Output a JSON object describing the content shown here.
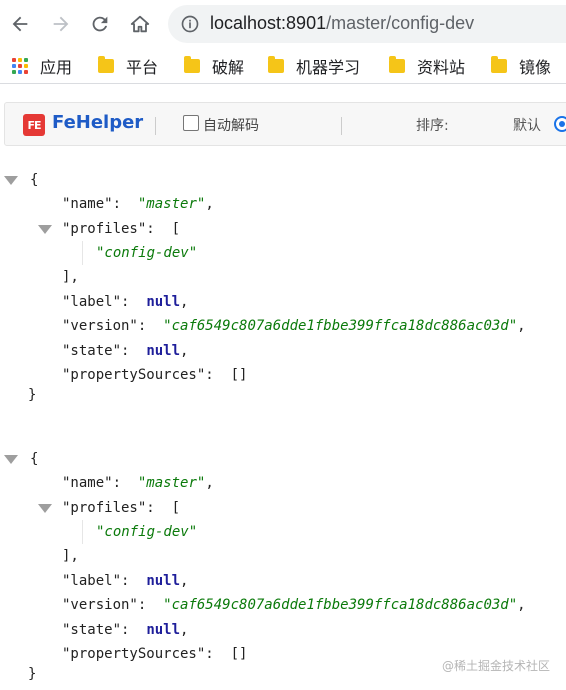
{
  "browser": {
    "url_host": "localhost:8901",
    "url_path": "/master/config-dev"
  },
  "bookmarks": [
    {
      "label": "应用",
      "icon": "apps-grid-icon"
    },
    {
      "label": "平台",
      "icon": "folder-icon"
    },
    {
      "label": "破解",
      "icon": "folder-icon"
    },
    {
      "label": "机器学习",
      "icon": "folder-icon"
    },
    {
      "label": "资料站",
      "icon": "folder-icon"
    },
    {
      "label": "镜像",
      "icon": "folder-icon"
    }
  ],
  "fehelper": {
    "logo": "FE",
    "title": "FeHelper",
    "auto_decode_label": "自动解码",
    "auto_decode_checked": false,
    "sort_label": "排序:",
    "default_label": "默认",
    "default_selected": true
  },
  "json_docs": [
    {
      "name_key": "\"name\"",
      "name_value": "\"master\"",
      "profiles_key": "\"profiles\"",
      "profiles_item": "\"config-dev\"",
      "label_key": "\"label\"",
      "label_value": "null",
      "version_key": "\"version\"",
      "version_value": "\"caf6549c807a6dde1fbbe399ffca18dc886ac03d\"",
      "state_key": "\"state\"",
      "state_value": "null",
      "sources_key": "\"propertySources\"",
      "sources_value": "[]"
    },
    {
      "name_key": "\"name\"",
      "name_value": "\"master\"",
      "profiles_key": "\"profiles\"",
      "profiles_item": "\"config-dev\"",
      "label_key": "\"label\"",
      "label_value": "null",
      "version_key": "\"version\"",
      "version_value": "\"caf6549c807a6dde1fbbe399ffca18dc886ac03d\"",
      "state_key": "\"state\"",
      "state_value": "null",
      "sources_key": "\"propertySources\"",
      "sources_value": "[]"
    }
  ],
  "watermark": "@稀土掘金技术社区",
  "colors": {
    "string": "#0b7a0b",
    "keyword": "#1e1e9a",
    "fehelper_title": "#1e5bc6",
    "fehelper_logo": "#e53935",
    "folder": "#f5c518"
  }
}
